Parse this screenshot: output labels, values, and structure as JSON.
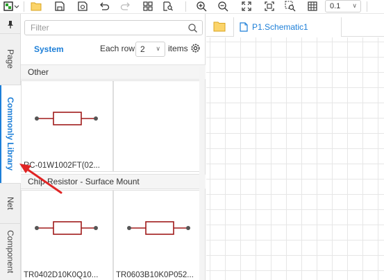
{
  "toolbar": {
    "zoom_value": "0.1",
    "icons": [
      "add-component-icon",
      "folder-icon",
      "save-icon",
      "save-copy-icon",
      "undo-icon",
      "redo-icon",
      "grid-objects-icon",
      "find-icon",
      "zoom-in-icon",
      "zoom-out-icon",
      "fit-icon",
      "zoom-area-icon",
      "zoom-selection-icon",
      "grid-icon"
    ]
  },
  "left_tabs": [
    {
      "label": "Page",
      "active": false
    },
    {
      "label": "Commonly Library",
      "active": true
    },
    {
      "label": "Net",
      "active": false
    },
    {
      "label": "Component",
      "active": false
    }
  ],
  "library": {
    "search_placeholder": "Filter",
    "source_tab": "System",
    "each_row_label": "Each row",
    "each_row_value": "2",
    "items_label": "items",
    "sections": [
      {
        "title": "Other",
        "items": [
          {
            "caption": "RC-01W1002FT(02..."
          }
        ]
      },
      {
        "title": "Chip Resistor - Surface Mount",
        "items": [
          {
            "caption": "TR0402D10K0Q10..."
          },
          {
            "caption": "TR0603B10K0P052..."
          }
        ]
      }
    ]
  },
  "document": {
    "tab_label": "P1.Schematic1"
  },
  "colors": {
    "accent": "#1d7fd8",
    "resistor": "#a01a1a",
    "annotation_arrow": "#e02424"
  }
}
